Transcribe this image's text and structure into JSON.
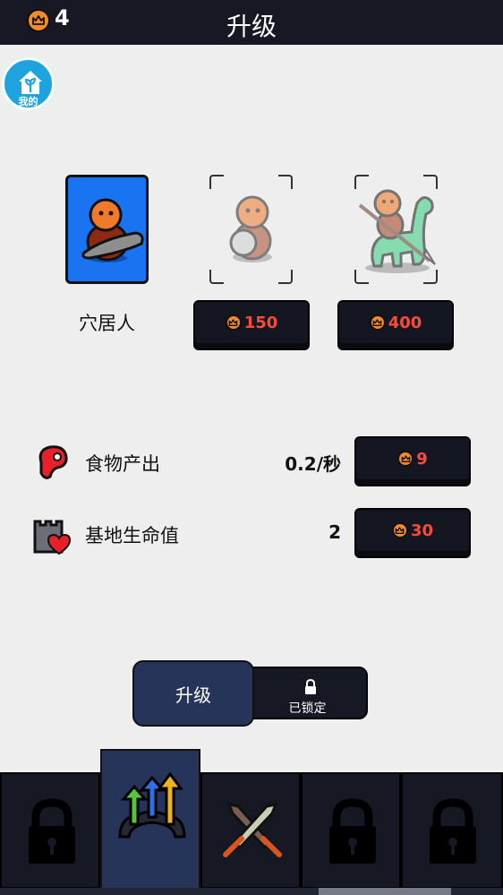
{
  "header": {
    "title": "升级",
    "crown_count": "4"
  },
  "my_button": {
    "label": "我的"
  },
  "units": [
    {
      "name": "穴居人",
      "state": "selected"
    },
    {
      "price": "150",
      "state": "locked"
    },
    {
      "price": "400",
      "state": "locked"
    }
  ],
  "stats": [
    {
      "label": "食物产出",
      "value": "0.2/秒",
      "cost": "9",
      "icon": "meat-icon"
    },
    {
      "label": "基地生命值",
      "value": "2",
      "cost": "30",
      "icon": "castle-heart-icon"
    }
  ],
  "segment": {
    "upgrade_label": "升级",
    "locked_label": "已锁定"
  },
  "tabs": [
    {
      "icon": "lock-icon",
      "active": false
    },
    {
      "icon": "upgrade-arrows-icon",
      "active": true
    },
    {
      "icon": "crossed-swords-icon",
      "active": false
    },
    {
      "icon": "lock-icon",
      "active": false
    },
    {
      "icon": "lock-icon",
      "active": false
    }
  ],
  "colors": {
    "topbar": "#161823",
    "accent_blue": "#1a73f0",
    "crown_orange": "#f28a2e",
    "price_red": "#ff4a3a",
    "tab_active": "#263459"
  }
}
